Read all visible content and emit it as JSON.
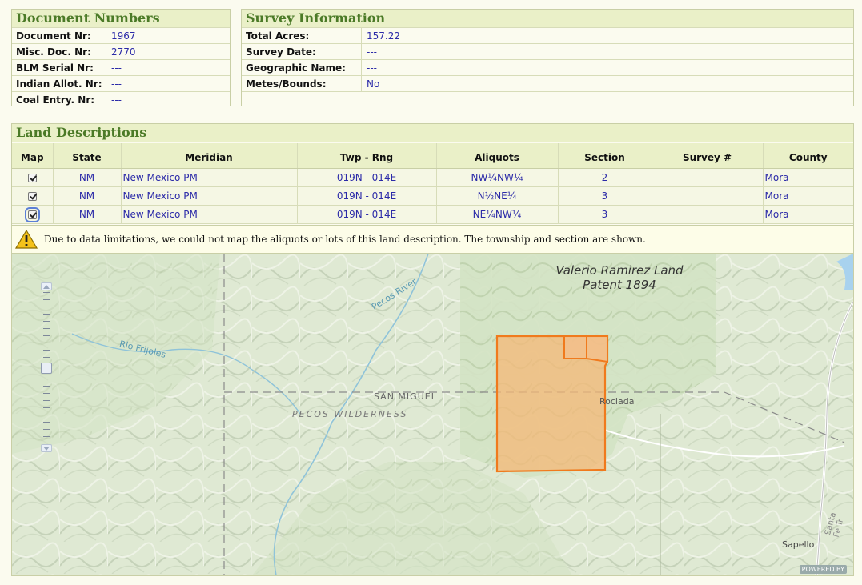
{
  "doc_numbers": {
    "title": "Document Numbers",
    "rows": [
      {
        "label": "Document Nr:",
        "value": "1967"
      },
      {
        "label": "Misc. Doc. Nr:",
        "value": "2770"
      },
      {
        "label": "BLM Serial Nr:",
        "value": "---"
      },
      {
        "label": "Indian Allot. Nr:",
        "value": "---"
      },
      {
        "label": "Coal Entry. Nr:",
        "value": "---"
      }
    ]
  },
  "survey": {
    "title": "Survey Information",
    "rows": [
      {
        "label": "Total Acres:",
        "value": "157.22"
      },
      {
        "label": "Survey Date:",
        "value": "---"
      },
      {
        "label": "Geographic Name:",
        "value": "---"
      },
      {
        "label": "Metes/Bounds:",
        "value": "No"
      }
    ]
  },
  "land": {
    "title": "Land Descriptions",
    "headers": [
      "Map",
      "State",
      "Meridian",
      "Twp - Rng",
      "Aliquots",
      "Section",
      "Survey #",
      "County"
    ],
    "rows": [
      {
        "state": "NM",
        "meridian": "New Mexico PM",
        "twp_rng": "019N - 014E",
        "aliquots": "NW¼NW¼",
        "section": "2",
        "survey": "",
        "county": "Mora"
      },
      {
        "state": "NM",
        "meridian": "New Mexico PM",
        "twp_rng": "019N - 014E",
        "aliquots": "N½NE¼",
        "section": "3",
        "survey": "",
        "county": "Mora"
      },
      {
        "state": "NM",
        "meridian": "New Mexico PM",
        "twp_rng": "019N - 014E",
        "aliquots": "NE¼NW¼",
        "section": "3",
        "survey": "",
        "county": "Mora"
      }
    ],
    "warning": "Due to data limitations, we could not map the aliquots or lots of this land description. The township and section are shown."
  },
  "map": {
    "labels": {
      "patent_line1": "Valerio Ramirez Land",
      "patent_line2": "Patent 1894",
      "pecos_river": "Pecos River",
      "rio_frijoles": "Rio Frijoles",
      "san_miguel": "SAN MIGUEL",
      "pecos_wilderness": "PECOS WILDERNESS",
      "rociada": "Rociada",
      "santa_fe": "Santa Fe Tr",
      "sapello": "Sapello",
      "attribution": "POWERED BY"
    },
    "parcel_color": "#f07a1d"
  }
}
